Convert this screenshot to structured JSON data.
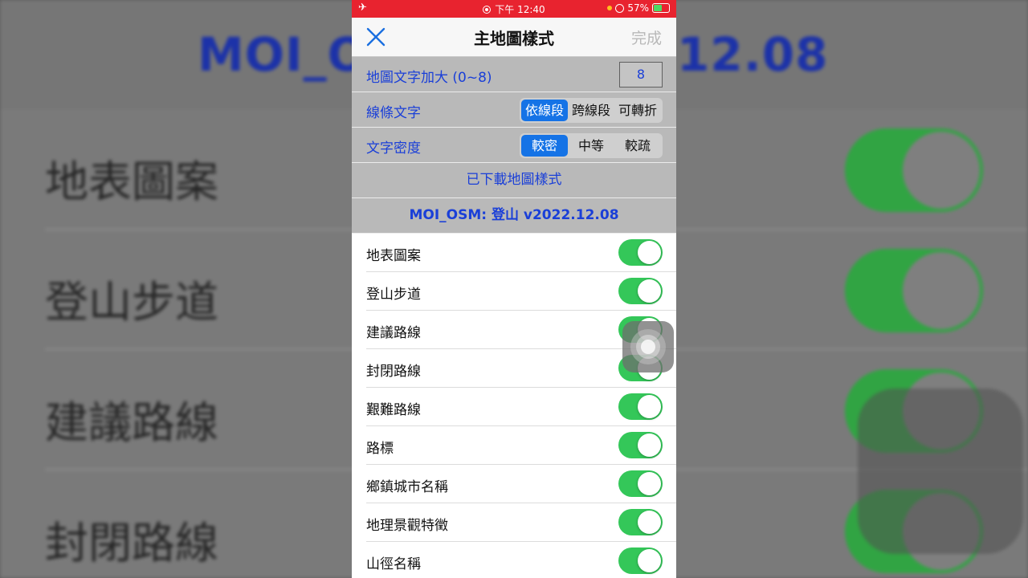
{
  "background": {
    "title_left": "MOI_O",
    "title_right": ".12.08",
    "rows": [
      "地表圖案",
      "登山步道",
      "建議路線",
      "封閉路線"
    ]
  },
  "status_bar": {
    "time": "下午 12:40",
    "battery": "57%",
    "color": "#e8232f"
  },
  "nav": {
    "title": "主地圖樣式",
    "done": "完成"
  },
  "settings": {
    "font_size": {
      "label": "地圖文字加大 (0~8)",
      "value": "8"
    },
    "line_text": {
      "label": "線條文字",
      "options": [
        "依線段",
        "跨線段",
        "可轉折"
      ],
      "selected": 0
    },
    "text_density": {
      "label": "文字密度",
      "options": [
        "較密",
        "中等",
        "較疏"
      ],
      "selected": 0
    }
  },
  "downloaded_label": "已下載地圖樣式",
  "style_name": "MOI_OSM: 登山 v2022.12.08",
  "layers": [
    {
      "name": "地表圖案",
      "on": true
    },
    {
      "name": "登山步道",
      "on": true
    },
    {
      "name": "建議路線",
      "on": true
    },
    {
      "name": "封閉路線",
      "on": true
    },
    {
      "name": "艱難路線",
      "on": true
    },
    {
      "name": "路標",
      "on": true
    },
    {
      "name": "鄉鎮城市名稱",
      "on": true
    },
    {
      "name": "地理景觀特徵",
      "on": true
    },
    {
      "name": "山徑名稱",
      "on": true
    }
  ],
  "colors": {
    "accent": "#1573e6",
    "label_blue": "#1a3fd8",
    "switch_on": "#34c759"
  },
  "icons": [
    "airplane-icon",
    "screen-record-icon",
    "orientation-lock-icon",
    "battery-icon",
    "close-icon",
    "assistive-touch-icon"
  ]
}
